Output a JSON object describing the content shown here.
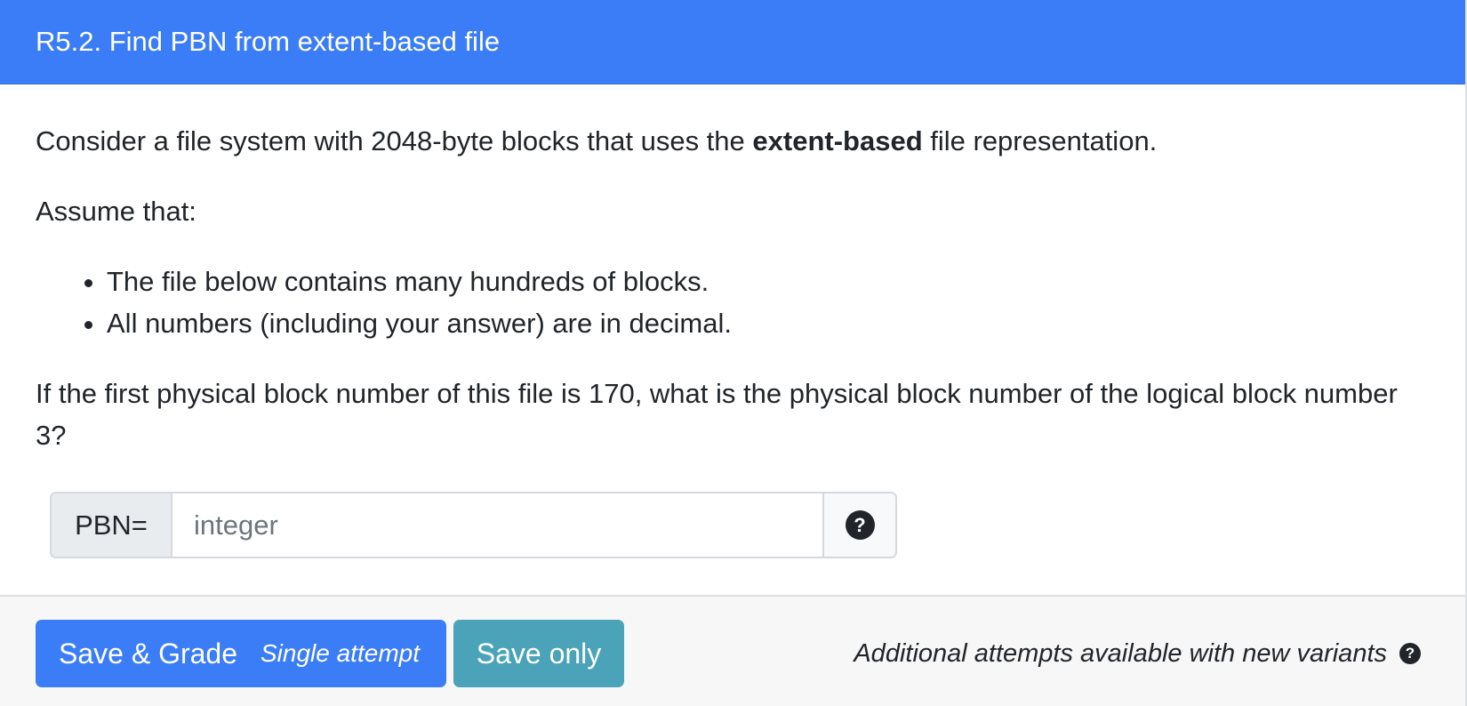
{
  "header": {
    "title": "R5.2. Find PBN from extent-based file"
  },
  "question": {
    "intro_before": "Consider a file system with 2048-byte blocks that uses the ",
    "intro_bold": "extent-based",
    "intro_after": " file representation.",
    "assume": "Assume that:",
    "bullets": [
      "The file below contains many hundreds of blocks.",
      "All numbers (including your answer) are in decimal."
    ],
    "prompt": "If the first physical block number of this file is 170, what is the physical block number of the logical block number 3?"
  },
  "answer": {
    "label": "PBN=",
    "placeholder": "integer",
    "value": "",
    "help_icon": "question-circle-icon"
  },
  "footer": {
    "grade_label": "Save & Grade",
    "grade_sub": "Single attempt",
    "save_label": "Save only",
    "attempts_text": "Additional attempts available with new variants",
    "help_icon": "question-circle-icon"
  },
  "colors": {
    "primary": "#3b7df6",
    "info": "#4aa3b8",
    "footer_bg": "#f7f7f7"
  }
}
